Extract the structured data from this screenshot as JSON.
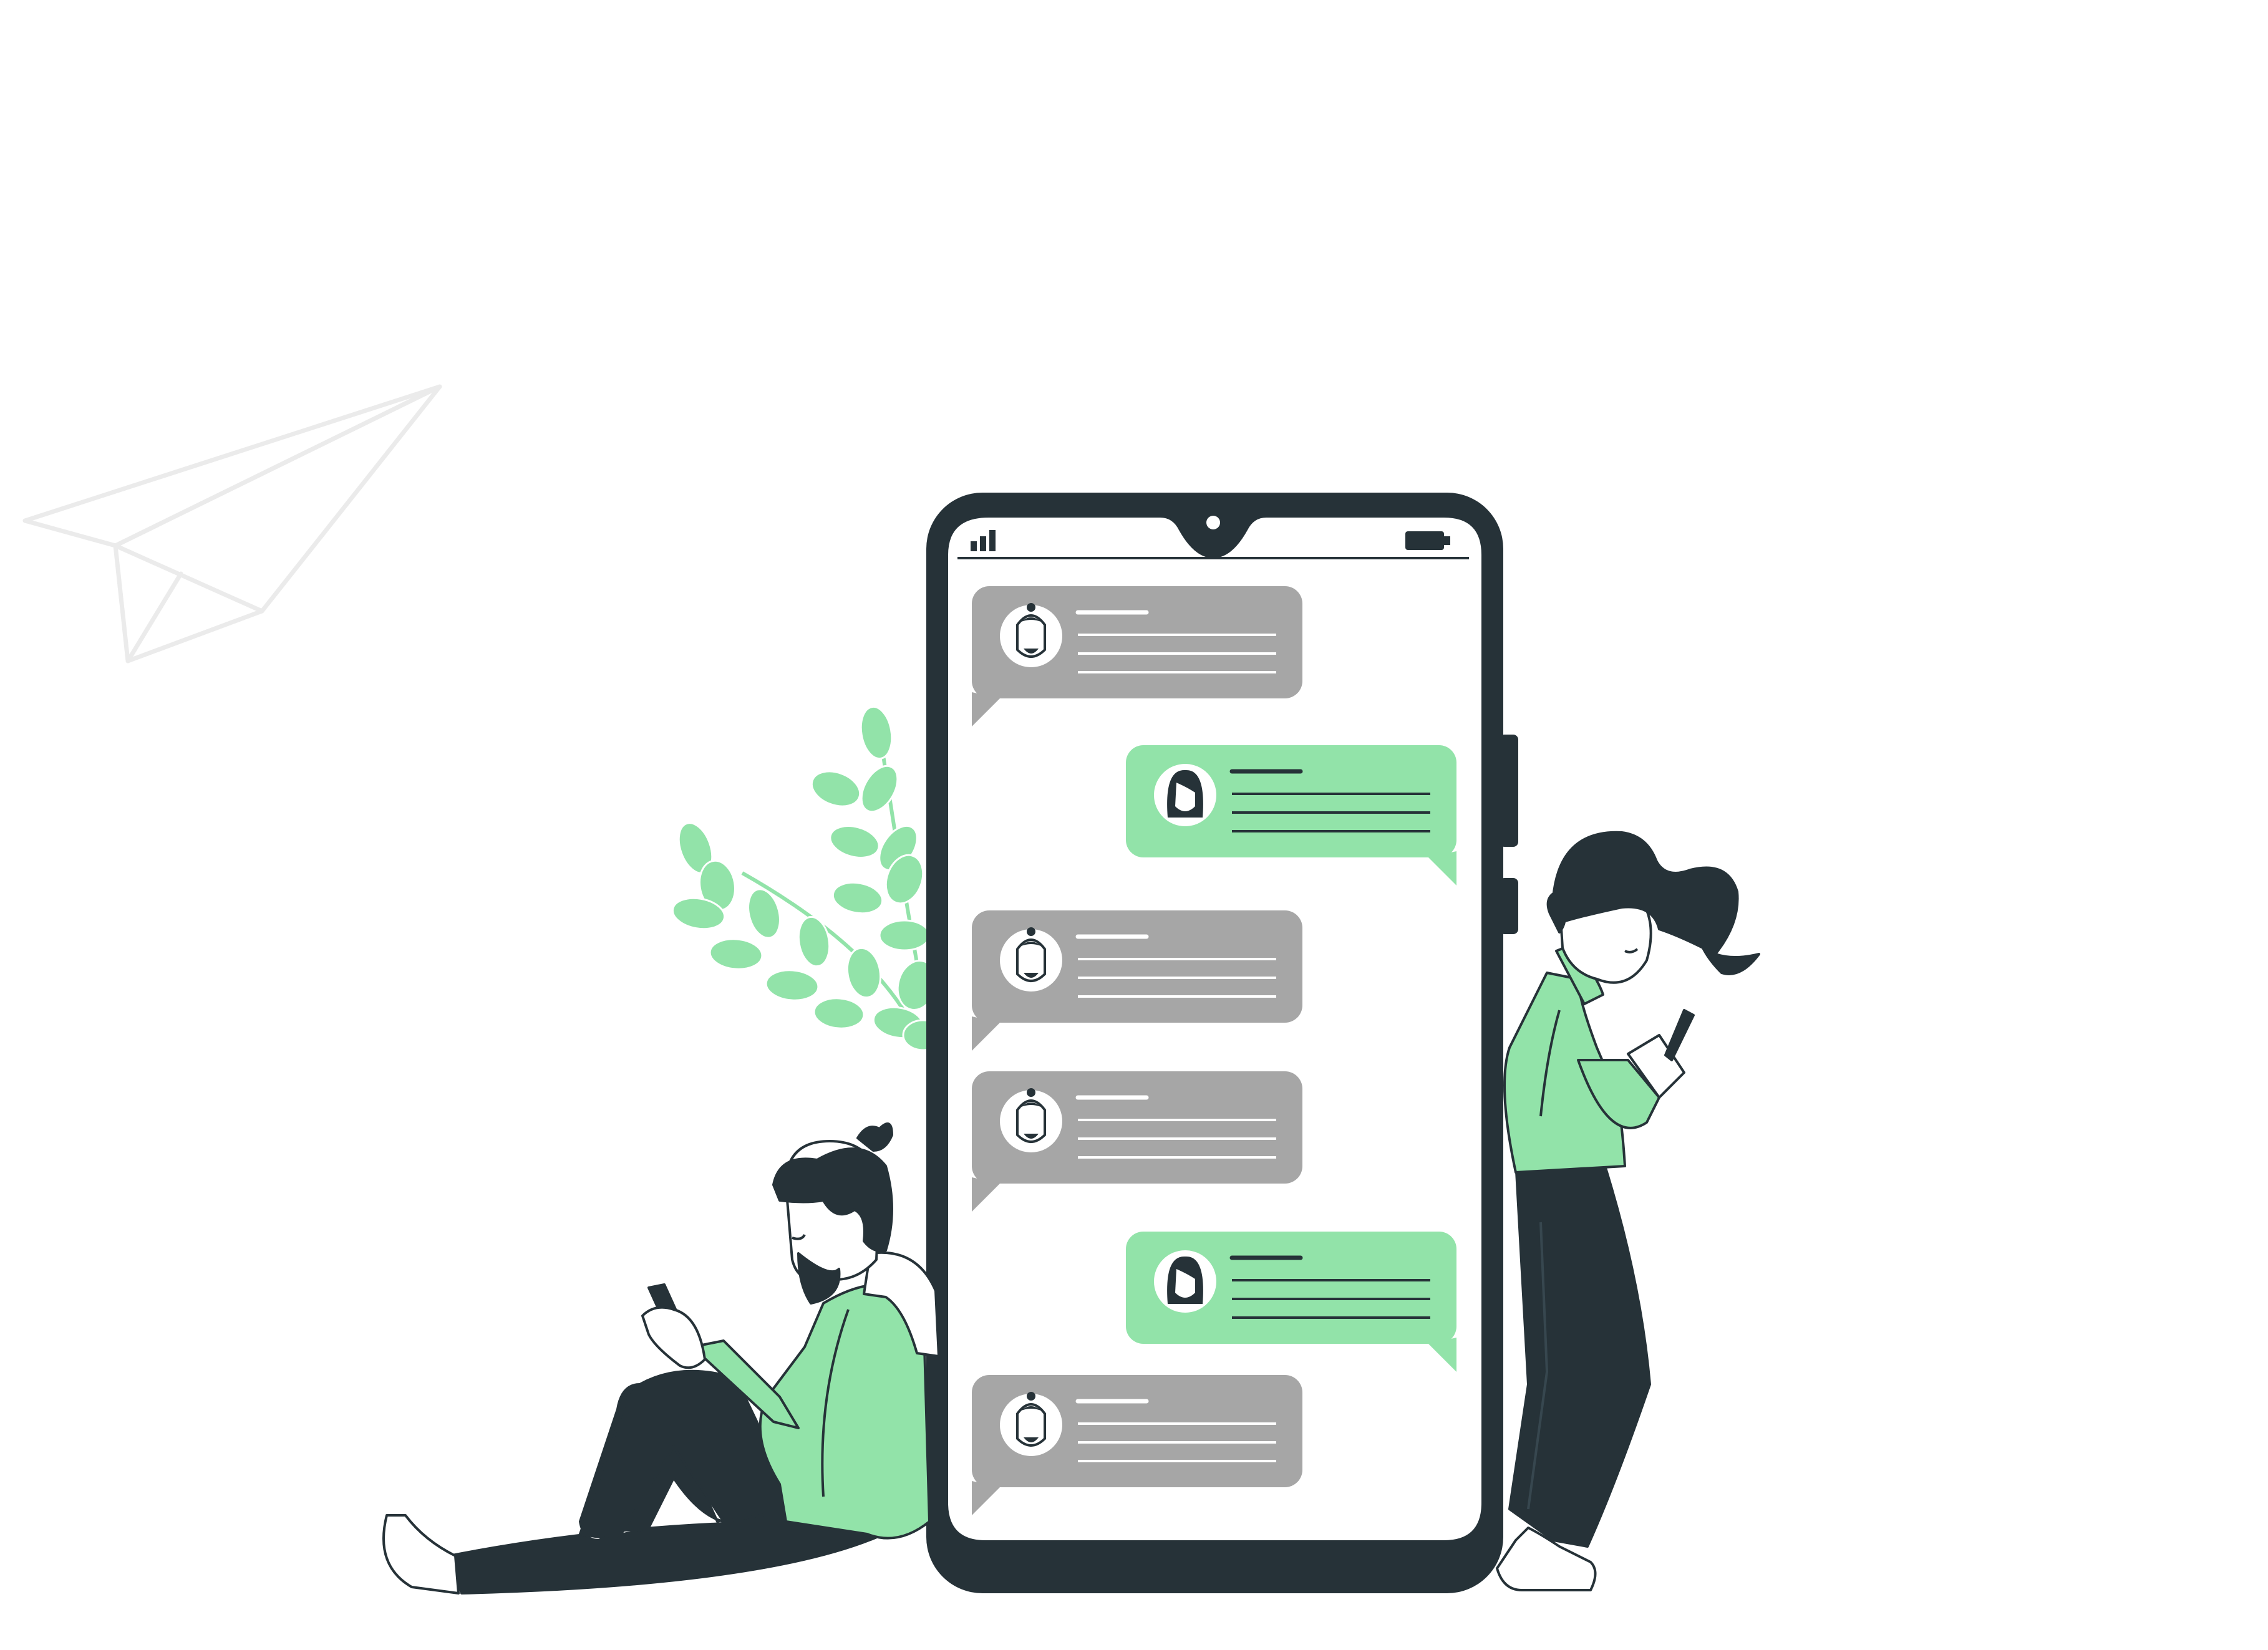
{
  "colors": {
    "background": "#ffffff",
    "dark": "#263238",
    "accent_green": "#92e3a9",
    "bubble_gray": "#a6a6a6",
    "outline_light": "#ebebeb",
    "white": "#ffffff"
  },
  "icons": {
    "paper_plane": "paper-plane-icon",
    "signal": "signal-bars-icon",
    "battery": "battery-icon",
    "front_camera": "front-camera-icon"
  },
  "chat": {
    "messages": [
      {
        "sender": "man",
        "side": "left",
        "color": "gray",
        "lines": 3
      },
      {
        "sender": "woman",
        "side": "right",
        "color": "green",
        "lines": 3
      },
      {
        "sender": "man",
        "side": "left",
        "color": "gray",
        "lines": 3
      },
      {
        "sender": "man",
        "side": "left",
        "color": "gray",
        "lines": 3
      },
      {
        "sender": "woman",
        "side": "right",
        "color": "green",
        "lines": 3
      },
      {
        "sender": "man",
        "side": "left",
        "color": "gray",
        "lines": 3
      }
    ]
  }
}
